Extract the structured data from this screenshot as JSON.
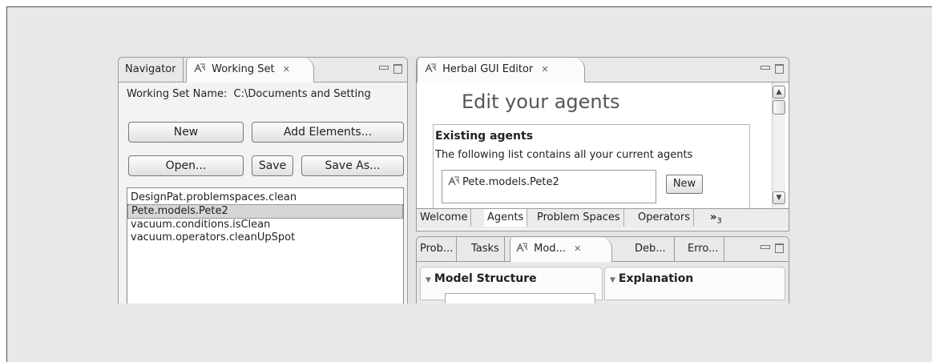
{
  "navigator_panel": {
    "tabs": [
      {
        "label": "Navigator",
        "active": false
      },
      {
        "label": "Working Set",
        "active": true,
        "icon": "agent-icon"
      }
    ],
    "working_set_label": "Working Set Name:",
    "working_set_value": "C:\\Documents and Setting",
    "buttons": {
      "new": "New",
      "add_elements": "Add Elements...",
      "open": "Open...",
      "save": "Save",
      "save_as": "Save As..."
    },
    "items": [
      {
        "label": "DesignPat.problemspaces.clean",
        "selected": false
      },
      {
        "label": "Pete.models.Pete2",
        "selected": true
      },
      {
        "label": "vacuum.conditions.isClean",
        "selected": false
      },
      {
        "label": "vacuum.operators.cleanUpSpot",
        "selected": false
      }
    ]
  },
  "editor_panel": {
    "tab_label": "Herbal GUI Editor",
    "heading": "Edit your agents",
    "section_title": "Existing agents",
    "section_desc": "The following list contains all your current agents",
    "agent_item": "Pete.models.Pete2",
    "new_button": "New",
    "bottom_tabs": [
      "Welcome",
      "Agents",
      "Problem Spaces",
      "Operators"
    ],
    "active_bottom_tab": "Agents",
    "overflow_label": "»",
    "overflow_count": "3"
  },
  "lower_panel": {
    "tabs": [
      "Prob...",
      "Tasks",
      "Mod...",
      "Deb...",
      "Erro..."
    ],
    "active_tab": "Mod...",
    "section_model_structure": "Model Structure",
    "section_explanation": "Explanation"
  },
  "icons": {
    "close": "close-icon",
    "minimize": "minimize-icon",
    "maximize": "maximize-icon",
    "agent": "agent-icon",
    "expand": "triangle-down-icon"
  }
}
